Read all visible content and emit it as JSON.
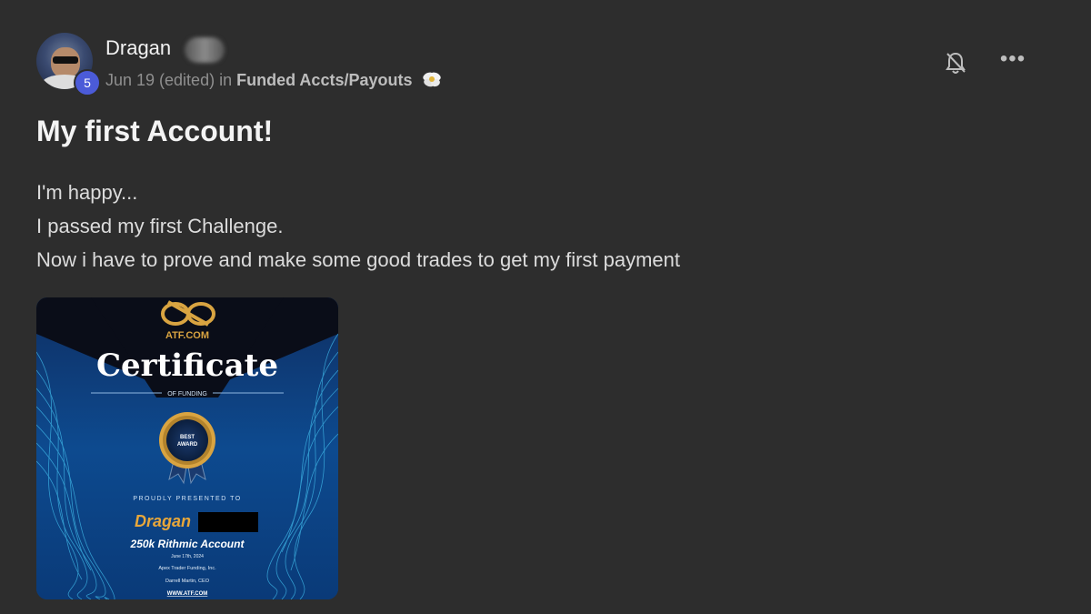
{
  "author": {
    "name": "Dragan",
    "level": "5"
  },
  "meta": {
    "date": "Jun 19 (edited) in",
    "category": "Funded Accts/Payouts"
  },
  "post": {
    "title": "My first Account!",
    "lines": [
      "I'm happy...",
      "I passed my first Challenge.",
      "Now i have to prove and make some good trades to get my first payment"
    ]
  },
  "certificate": {
    "brand": "ATF.COM",
    "heading": "Certificate",
    "subheading": "OF FUNDING",
    "seal_line1": "BEST",
    "seal_line2": "AWARD",
    "presented": "PROUDLY PRESENTED TO",
    "recipient": "Dragan",
    "account": "250k Rithmic Account",
    "date": "June 17th, 2024",
    "company": "Apex Trader Funding, Inc.",
    "signer": "Darrell Martin, CEO",
    "website": "WWW.ATF.COM"
  },
  "colors": {
    "background": "#2d2d2d",
    "badge": "#4b5bd8",
    "cert_gold": "#d9a441",
    "cert_blue": "#0d3f7a"
  },
  "icons": {
    "bell": "bell-off-icon",
    "more": "more-options-icon",
    "category": "flower-icon"
  }
}
